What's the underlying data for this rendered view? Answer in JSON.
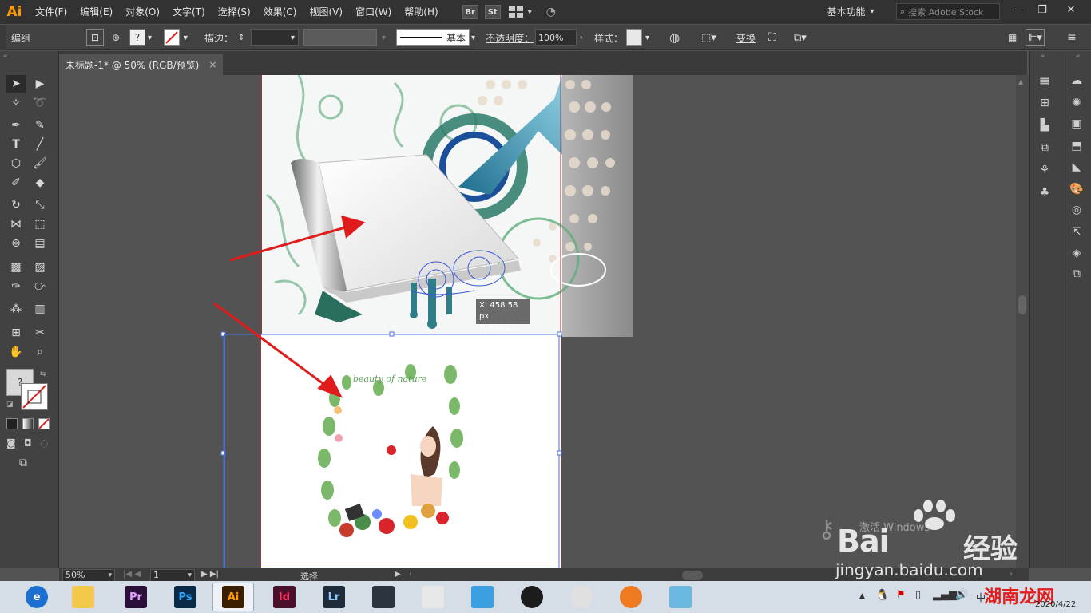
{
  "app": {
    "logo": "Ai"
  },
  "menu": [
    "文件(F)",
    "编辑(E)",
    "对象(O)",
    "文字(T)",
    "选择(S)",
    "效果(C)",
    "视图(V)",
    "窗口(W)",
    "帮助(H)"
  ],
  "menubar_icons": {
    "bridge": "Br",
    "stock": "St"
  },
  "workspace": "基本功能",
  "stock_search_placeholder": "搜索 Adobe Stock",
  "control": {
    "group_label": "编组",
    "stroke_label": "描边：",
    "stroke_style": "基本",
    "opacity_label": "不透明度：",
    "opacity_value": "100%",
    "style_label": "样式：",
    "transform_label": "变换",
    "question_mark": "?"
  },
  "document_tab": {
    "title": "未标题-1* @ 50% (RGB/预览)",
    "close": "×"
  },
  "canvas": {
    "coord_x": "X: 458.58 px",
    "coord_y": "Y: 650.21 px",
    "artwork_text": "beauty of nature"
  },
  "status": {
    "zoom": "50%",
    "page": "1",
    "tool": "选择"
  },
  "watermark": {
    "brand": "Bai",
    "brand2": "经验",
    "site": "jingyan.baidu.com",
    "activate": "激活 Windows"
  },
  "taskbar": {
    "apps": [
      {
        "name": "edge",
        "label": "e",
        "color": "#1b6fd1"
      },
      {
        "name": "explorer",
        "label": "",
        "color": "#f4c84a"
      },
      {
        "name": "premiere",
        "label": "Pr",
        "color": "#2a0f3a"
      },
      {
        "name": "photoshop",
        "label": "Ps",
        "color": "#0b2a4a"
      },
      {
        "name": "illustrator",
        "label": "Ai",
        "color": "#3b1e00"
      },
      {
        "name": "indesign",
        "label": "Id",
        "color": "#4a0f2a"
      },
      {
        "name": "lightroom",
        "label": "Lr",
        "color": "#1e2c3a"
      },
      {
        "name": "video",
        "label": "",
        "color": "#2a3540"
      },
      {
        "name": "umbrella",
        "label": "",
        "color": "#e8e8e8"
      },
      {
        "name": "helper",
        "label": "",
        "color": "#3aa0e0"
      },
      {
        "name": "qq",
        "label": "",
        "color": "#1c1c1c"
      },
      {
        "name": "chrome",
        "label": "",
        "color": "#e0e0e0"
      },
      {
        "name": "fox",
        "label": "",
        "color": "#f07a20"
      },
      {
        "name": "notes",
        "label": "",
        "color": "#6ab7e0"
      }
    ],
    "ime": "中",
    "date": "2020/4/22",
    "site_logo": "湖南龙网"
  }
}
